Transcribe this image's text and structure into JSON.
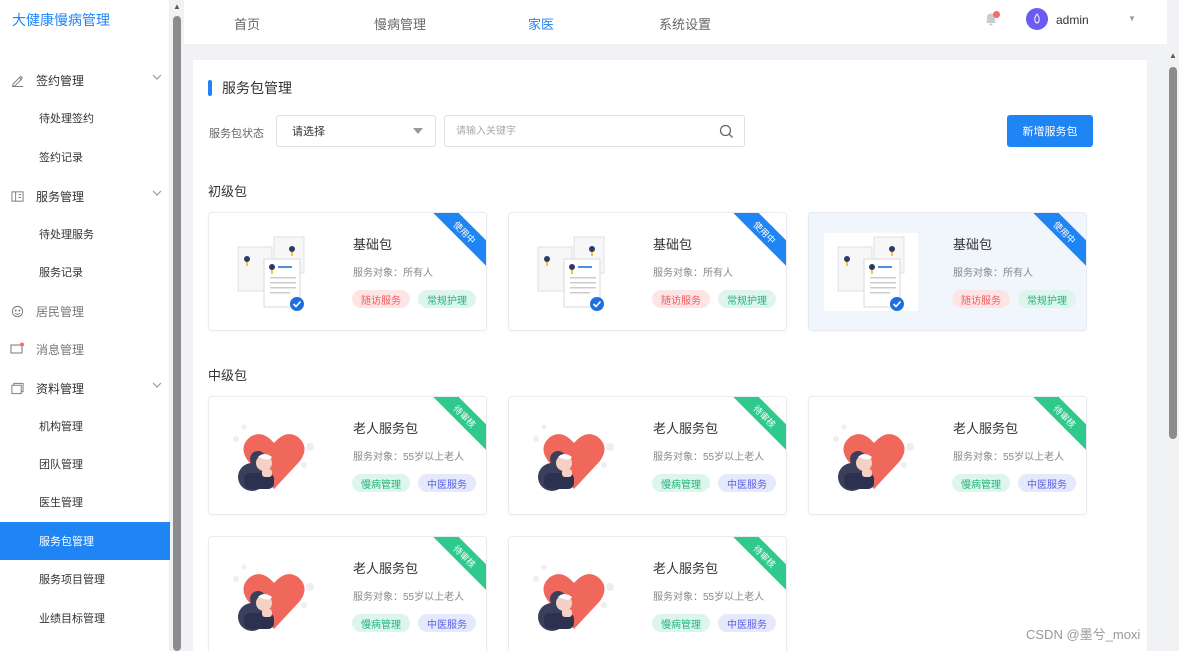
{
  "app": {
    "title": "大健康慢病管理"
  },
  "sidebar": {
    "groups": [
      {
        "label": "签约管理",
        "icon": "edit-icon",
        "items": [
          "待处理签约",
          "签约记录"
        ]
      },
      {
        "label": "服务管理",
        "icon": "service-icon",
        "items": [
          "待处理服务",
          "服务记录"
        ]
      },
      {
        "label": "居民管理",
        "icon": "resident-icon",
        "items": []
      },
      {
        "label": "消息管理",
        "icon": "message-icon",
        "items": []
      },
      {
        "label": "资料管理",
        "icon": "folder-icon",
        "items": [
          "机构管理",
          "团队管理",
          "医生管理",
          "服务包管理",
          "服务项目管理",
          "业绩目标管理"
        ]
      }
    ],
    "active_item": "服务包管理"
  },
  "topnav": {
    "items": [
      "首页",
      "慢病管理",
      "家医",
      "系统设置"
    ],
    "active": "家医",
    "user": "admin"
  },
  "page": {
    "title": "服务包管理",
    "filter_label": "服务包状态",
    "select_value": "请选择",
    "search_placeholder": "请输入关键字",
    "add_button": "新增服务包"
  },
  "groups": [
    {
      "title": "初级包",
      "cards": [
        {
          "title": "基础包",
          "desc": "服务对象：所有人",
          "status": "使用中",
          "tags": [
            "随访服务",
            "常规护理"
          ]
        },
        {
          "title": "基础包",
          "desc": "服务对象：所有人",
          "status": "使用中",
          "tags": [
            "随访服务",
            "常规护理"
          ]
        },
        {
          "title": "基础包",
          "desc": "服务对象：所有人",
          "status": "使用中",
          "tags": [
            "随访服务",
            "常规护理"
          ]
        }
      ]
    },
    {
      "title": "中级包",
      "cards": [
        {
          "title": "老人服务包",
          "desc": "服务对象：55岁以上老人",
          "status": "待审核",
          "tags": [
            "慢病管理",
            "中医服务"
          ]
        },
        {
          "title": "老人服务包",
          "desc": "服务对象：55岁以上老人",
          "status": "待审核",
          "tags": [
            "慢病管理",
            "中医服务"
          ]
        },
        {
          "title": "老人服务包",
          "desc": "服务对象：55岁以上老人",
          "status": "待审核",
          "tags": [
            "慢病管理",
            "中医服务"
          ]
        },
        {
          "title": "老人服务包",
          "desc": "服务对象：55岁以上老人",
          "status": "待审核",
          "tags": [
            "慢病管理",
            "中医服务"
          ]
        },
        {
          "title": "老人服务包",
          "desc": "服务对象：55岁以上老人",
          "status": "待审核",
          "tags": [
            "慢病管理",
            "中医服务"
          ]
        }
      ]
    }
  ],
  "colors": {
    "primary": "#1f84f4",
    "approved": "#2ec98b",
    "tag_red": "#f05b5b",
    "tag_green": "#22b57b",
    "tag_purple": "#5b63e0"
  },
  "watermark": "CSDN @墨兮_moxi"
}
